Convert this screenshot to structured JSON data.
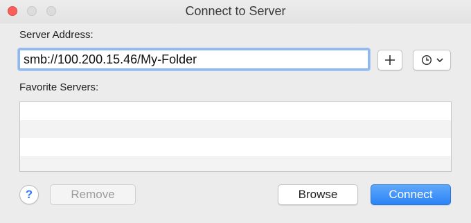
{
  "window": {
    "title": "Connect to Server"
  },
  "server_address": {
    "label": "Server Address:",
    "value": "smb://100.200.15.46/My-Folder",
    "add_icon": "plus-icon",
    "history_icon": "clock-icon"
  },
  "favorites": {
    "label": "Favorite Servers:",
    "items": []
  },
  "buttons": {
    "help_label": "?",
    "remove_label": "Remove",
    "browse_label": "Browse",
    "connect_label": "Connect"
  },
  "colors": {
    "accent": "#2b83f6",
    "close": "#fc605b",
    "focus_ring": "#8fb8f0"
  }
}
